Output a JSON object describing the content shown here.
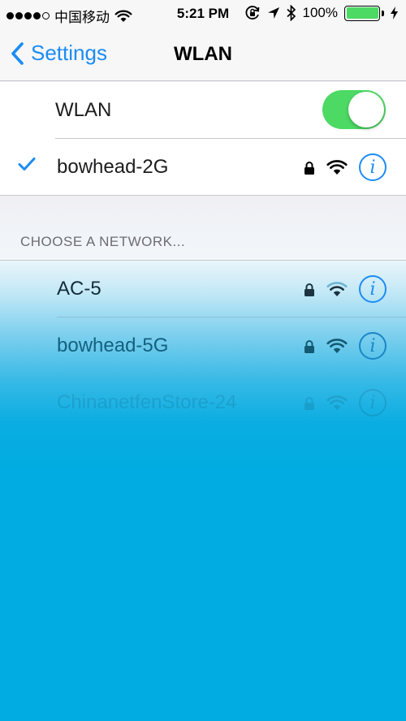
{
  "status_bar": {
    "carrier": "中国移动",
    "time": "5:21 PM",
    "battery_percent": "100%",
    "battery_level": 1.0
  },
  "nav": {
    "back_label": "Settings",
    "title": "WLAN"
  },
  "wlan": {
    "label": "WLAN",
    "enabled": true,
    "connected_network": "bowhead-2G"
  },
  "networks": {
    "header": "CHOOSE A NETWORK...",
    "items": [
      {
        "name": "AC-5",
        "locked": true
      },
      {
        "name": "bowhead-5G",
        "locked": true
      },
      {
        "name": "ChinanetfenStore-24",
        "locked": true
      }
    ]
  },
  "colors": {
    "accent": "#1b8cf5",
    "toggle_on": "#4cd964",
    "overlay": "#00ace1"
  },
  "icons": [
    "wifi-icon",
    "lock-icon",
    "info-icon",
    "checkmark-icon",
    "chevron-left-icon",
    "location-arrow-icon",
    "bluetooth-icon",
    "orientation-lock-icon",
    "battery-icon",
    "charging-icon"
  ]
}
